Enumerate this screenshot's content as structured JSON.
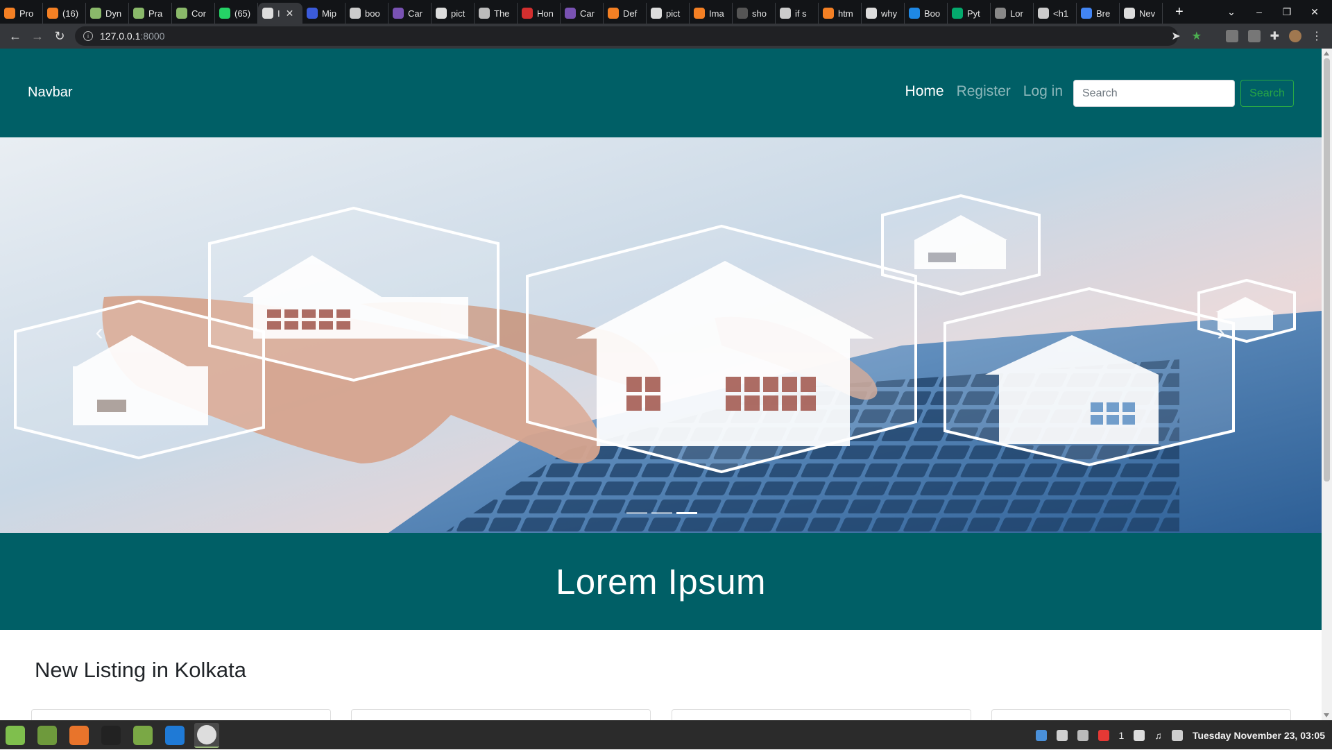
{
  "browser": {
    "tabs": [
      {
        "title": "Pro",
        "icon": "stackoverflow-icon",
        "color": "#f48024"
      },
      {
        "title": "(16)",
        "icon": "stackoverflow-icon",
        "color": "#f48024"
      },
      {
        "title": "Dyn",
        "icon": "codepen-like-icon",
        "color": "#8ab96a"
      },
      {
        "title": "Pra",
        "icon": "codepen-like-icon",
        "color": "#8ab96a"
      },
      {
        "title": "Cor",
        "icon": "codepen-like-icon",
        "color": "#8ab96a"
      },
      {
        "title": "(65)",
        "icon": "whatsapp-icon",
        "color": "#25d366"
      },
      {
        "title": "I",
        "icon": "globe-icon",
        "color": "#dddddd",
        "active": true
      },
      {
        "title": "Mip",
        "icon": "bar-chart-icon",
        "color": "#3b5bdb"
      },
      {
        "title": "boo",
        "icon": "chatgpt-icon",
        "color": "#cccccc"
      },
      {
        "title": "Car",
        "icon": "bootstrap-icon",
        "color": "#7952b3"
      },
      {
        "title": "pict",
        "icon": "google-icon",
        "color": "#dddddd"
      },
      {
        "title": "The",
        "icon": "feather-icon",
        "color": "#bbbbbb"
      },
      {
        "title": "Hon",
        "icon": "home-icon",
        "color": "#d32f2f"
      },
      {
        "title": "Car",
        "icon": "bootstrap-icon",
        "color": "#7952b3"
      },
      {
        "title": "Def",
        "icon": "stackoverflow-icon",
        "color": "#f48024"
      },
      {
        "title": "pict",
        "icon": "google-icon",
        "color": "#dddddd"
      },
      {
        "title": "Ima",
        "icon": "stackoverflow-icon",
        "color": "#f48024"
      },
      {
        "title": "sho",
        "icon": "github-icon",
        "color": "#555555"
      },
      {
        "title": "if s",
        "icon": "grid-icon",
        "color": "#cccccc"
      },
      {
        "title": "htm",
        "icon": "stackoverflow-icon",
        "color": "#f48024"
      },
      {
        "title": "why",
        "icon": "google-icon",
        "color": "#dddddd"
      },
      {
        "title": "Boo",
        "icon": "shield-icon",
        "color": "#1e88e5"
      },
      {
        "title": "Pyt",
        "icon": "w3schools-icon",
        "color": "#04aa6d"
      },
      {
        "title": "Lor",
        "icon": "lorem-icon",
        "color": "#888888"
      },
      {
        "title": "<h1",
        "icon": "chat-icon",
        "color": "#cccccc"
      },
      {
        "title": "Bre",
        "icon": "refresh-icon",
        "color": "#4285f4"
      },
      {
        "title": "Nev",
        "icon": "globe-icon",
        "color": "#dddddd"
      }
    ],
    "new_tab": "+",
    "url_host": "127.0.0.1",
    "url_port": ":8000"
  },
  "site": {
    "brand": "Navbar",
    "nav": {
      "home": "Home",
      "register": "Register",
      "login": "Log in"
    },
    "search_placeholder": "Search",
    "search_button": "Search",
    "banner_title": "Lorem Ipsum",
    "listing_title": "New Listing in Kolkata",
    "carousel_indicator_count": 3,
    "carousel_active_index": 2
  },
  "taskbar": {
    "apps": [
      "mint-menu-icon",
      "files-icon",
      "firefox-icon",
      "terminal-icon",
      "folder-icon",
      "vscode-icon",
      "chrome-icon"
    ],
    "tray_badge": "1",
    "clock": "Tuesday November 23, 03:05"
  },
  "colors": {
    "brand_teal": "#005f66",
    "search_green": "#28a745"
  }
}
